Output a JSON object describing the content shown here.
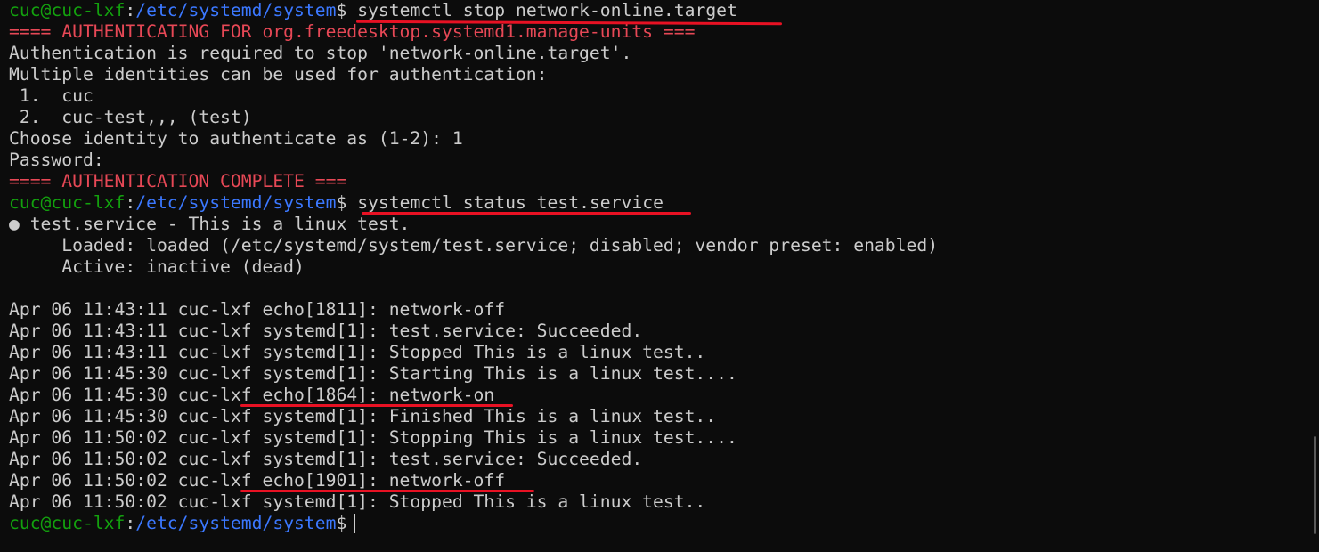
{
  "prompt": {
    "user_host": "cuc@cuc-lxf",
    "sep": ":",
    "path": "/etc/systemd/system",
    "symbol": "$"
  },
  "commands": {
    "stop": "systemctl stop network-online.target",
    "status": "systemctl status test.service"
  },
  "auth": {
    "header": "==== AUTHENTICATING FOR org.freedesktop.systemd1.manage-units ===",
    "required": "Authentication is required to stop 'network-online.target'.",
    "multiple": "Multiple identities can be used for authentication:",
    "id1": " 1.  cuc",
    "id2": " 2.  cuc-test,,, (test)",
    "choose": "Choose identity to authenticate as (1-2): 1",
    "password": "Password:",
    "complete": "==== AUTHENTICATION COMPLETE ==="
  },
  "status": {
    "title": "● test.service - This is a linux test.",
    "loaded": "     Loaded: loaded (/etc/systemd/system/test.service; disabled; vendor preset: enabled)",
    "active": "     Active: inactive (dead)"
  },
  "log_lines": [
    "Apr 06 11:43:11 cuc-lxf echo[1811]: network-off",
    "Apr 06 11:43:11 cuc-lxf systemd[1]: test.service: Succeeded.",
    "Apr 06 11:43:11 cuc-lxf systemd[1]: Stopped This is a linux test..",
    "Apr 06 11:45:30 cuc-lxf systemd[1]: Starting This is a linux test....",
    "Apr 06 11:45:30 cuc-lxf echo[1864]: network-on",
    "Apr 06 11:45:30 cuc-lxf systemd[1]: Finished This is a linux test..",
    "Apr 06 11:50:02 cuc-lxf systemd[1]: Stopping This is a linux test....",
    "Apr 06 11:50:02 cuc-lxf systemd[1]: test.service: Succeeded.",
    "Apr 06 11:50:02 cuc-lxf echo[1901]: network-off",
    "Apr 06 11:50:02 cuc-lxf systemd[1]: Stopped This is a linux test.."
  ],
  "colors": {
    "background": "#0c0c0c",
    "text": "#cccccc",
    "user_host": "#13a10e",
    "path": "#3b78ff",
    "alert": "#e74856",
    "annotation": "#e81123"
  }
}
